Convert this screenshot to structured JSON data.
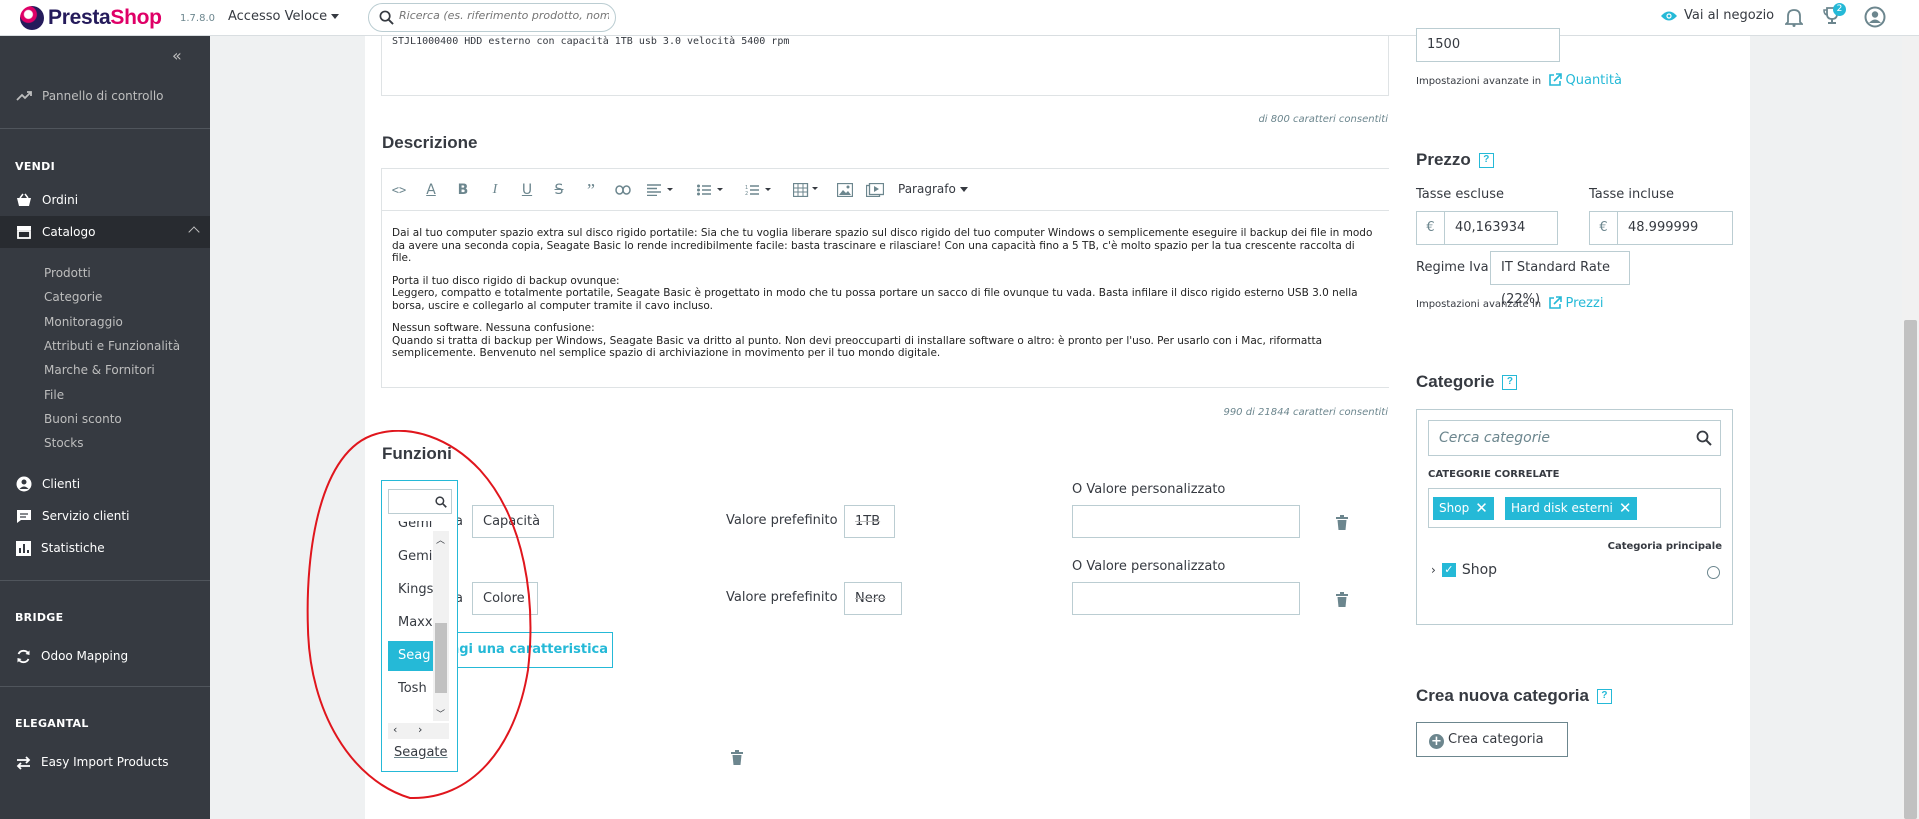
{
  "topbar": {
    "brand_a": "Presta",
    "brand_b": "Shop",
    "version": "1.7.8.0",
    "quick_access": "Accesso Veloce",
    "search_placeholder": "Ricerca (es. riferimento prodotto, nome",
    "visit_store": "Vai al negozio",
    "notifications_badge": "2"
  },
  "sidebar": {
    "dashboard": "Pannello di controllo",
    "section_sell": "VENDI",
    "orders": "Ordini",
    "catalog": "Catalogo",
    "catalog_items": [
      "Prodotti",
      "Categorie",
      "Monitoraggio",
      "Attributi e Funzionalità",
      "Marche & Fornitori",
      "File",
      "Buoni sconto",
      "Stocks"
    ],
    "customers": "Clienti",
    "customer_service": "Servizio clienti",
    "stats": "Statistiche",
    "section_bridge": "BRIDGE",
    "odoo": "Odoo Mapping",
    "section_elegantal": "ELEGANTAL",
    "easy_import": "Easy Import Products"
  },
  "summary": {
    "text": "STJL1000400 HDD esterno con capacità 1TB usb 3.0 velocità 5400 rpm",
    "count": "di 800 caratteri consentiti"
  },
  "description": {
    "title": "Descrizione",
    "paragraph_menu": "Paragrafo",
    "p1": "Dai al tuo computer spazio extra sul disco rigido portatile: Sia che tu voglia liberare spazio sul disco rigido del tuo computer Windows o semplicemente eseguire il backup dei file in modo da avere una seconda copia, Seagate Basic lo rende incredibilmente facile: basta trascinare e rilasciare! Con una capacità fino a 5 TB, c'è molto spazio per la tua crescente raccolta di file.",
    "p2a": "Porta il tuo disco rigido di backup ovunque:",
    "p2b": "Leggero, compatto e totalmente portatile, Seagate Basic è progettato in modo che tu possa portare un sacco di file ovunque tu vada. Basta infilare il disco rigido esterno USB 3.0 nella borsa, uscire e collegarlo al computer tramite il cavo incluso.",
    "p3a": "Nessun software. Nessuna confusione:",
    "p3b": "Quando si tratta di backup per Windows, Seagate Basic va dritto al punto. Non devi preoccuparti di installare software o altro: è pronto per l'uso. Per usarlo con i Mac, riformatta semplicemente. Benvenuto nel semplice spazio di archiviazione in movimento per il tuo mondo digitale.",
    "count": "990 di 21844 caratteri consentiti"
  },
  "features": {
    "title": "Funzioni",
    "label_suffix": "a",
    "rows": [
      {
        "feature": "Capacità",
        "default_label": "Valore prefefinito",
        "default_value": "1TB",
        "custom_label": "O Valore personalizzato"
      },
      {
        "feature": "Colore",
        "default_label": "Valore prefefinito",
        "default_value": "Nero",
        "custom_label": "O Valore personalizzato"
      }
    ],
    "add_button": "ngi una caratteristica",
    "dropdown_options": [
      "Gemi",
      "Gemi",
      "Kings",
      "Maxx",
      "Seag",
      "Tosh"
    ],
    "dropdown_selected_index": 4,
    "dropdown_value": "Seagate"
  },
  "right": {
    "quantity_value": "1500",
    "advanced_settings": "Impostazioni avanzate in",
    "quantity_link": "Quantità",
    "price_title": "Prezzo",
    "tax_excl_label": "Tasse escluse",
    "tax_excl_value": "40,163934",
    "tax_incl_label": "Tasse incluse",
    "tax_incl_value": "48.999999",
    "currency": "€",
    "vat_label": "Regime Iva",
    "vat_value": "IT Standard Rate (22%)",
    "price_link": "Prezzi",
    "categories_title": "Categorie",
    "categories_search": "Cerca categorie",
    "related_label": "CATEGORIE CORRELATE",
    "tags": [
      "Shop",
      "Hard disk esterni"
    ],
    "main_category_label": "Categoria principale",
    "tree_item": "Shop",
    "new_category_title": "Crea nuova categoria",
    "create_button": "Crea categoria",
    "help": "?"
  },
  "colors": {
    "accent": "#25b9d7",
    "sidebar": "#363a41",
    "annotation": "#e0161d"
  }
}
